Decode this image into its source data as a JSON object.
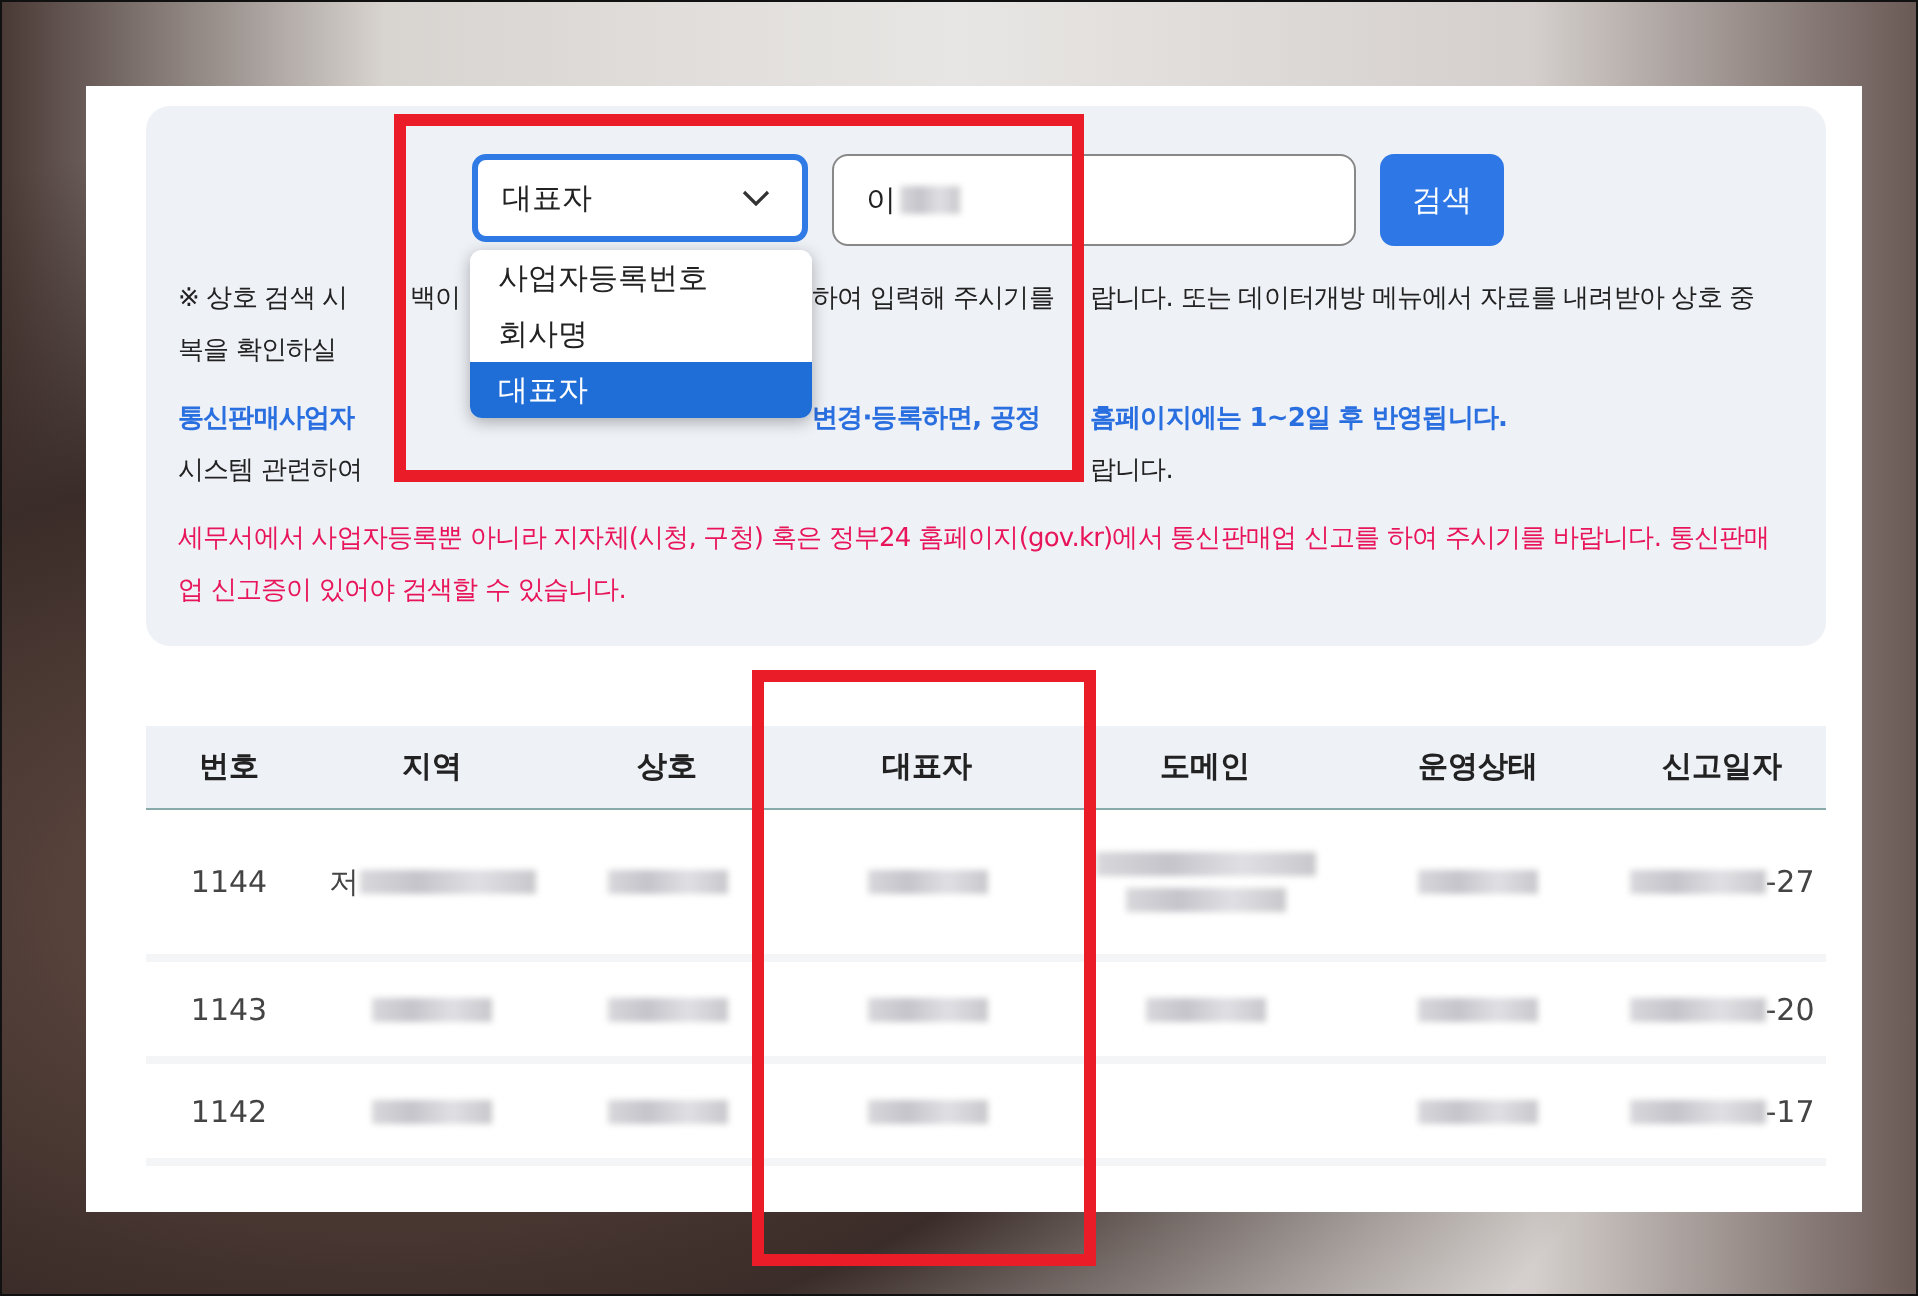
{
  "search": {
    "select": {
      "value": "대표자",
      "expanded": true
    },
    "options": [
      {
        "label": "사업자등록번호",
        "selected": false
      },
      {
        "label": "회사명",
        "selected": false
      },
      {
        "label": "대표자",
        "selected": true
      }
    ],
    "query": {
      "value": "이",
      "redacted": true
    },
    "button": "검색"
  },
  "notice": [
    {
      "kind": "plain",
      "left": "※ 상호 검색 시",
      "after_mark": "백이",
      "right": "하여 입력해 주시기를",
      "tail": "랍니다. 또는 데이터개방 메뉴에서 자료를 내려받아 상호 중"
    },
    {
      "kind": "plain",
      "left": "복을 확인하실"
    },
    {
      "kind": "highlight",
      "left": "통신판매사업자",
      "right": "변경·등록하면, 공정",
      "tail": "홈페이지에는 1~2일 후 반영됩니다."
    },
    {
      "kind": "plain",
      "left": "시스템 관련하여",
      "tail": "랍니다."
    },
    {
      "kind": "warning",
      "text": "세무서에서 사업자등록뿐 아니라 지자체(시청, 구청) 혹은 정부24 홈페이지(gov.kr)에서 통신판매업 신고를 하여 주시기를 바랍니다. 통신판매업 신고증이 있어야 검색할 수 있습니다."
    }
  ],
  "table": {
    "columns": [
      "번호",
      "지역",
      "상호",
      "대표자",
      "도메인",
      "운영상태",
      "신고일자"
    ],
    "rows": [
      {
        "cells": [
          {
            "text": "1144",
            "kind": "plain"
          },
          {
            "text": "저",
            "kind": "after"
          },
          {
            "kind": "full"
          },
          {
            "kind": "full"
          },
          {
            "kind": "double"
          },
          {
            "kind": "full"
          },
          {
            "text": "-27",
            "kind": "before"
          }
        ]
      },
      {
        "cells": [
          {
            "text": "1143",
            "kind": "plain"
          },
          {
            "kind": "full"
          },
          {
            "kind": "full"
          },
          {
            "kind": "full"
          },
          {
            "kind": "full"
          },
          {
            "kind": "full"
          },
          {
            "text": "-20",
            "kind": "before"
          }
        ]
      },
      {
        "cells": [
          {
            "text": "1142",
            "kind": "plain"
          },
          {
            "kind": "full"
          },
          {
            "kind": "full"
          },
          {
            "kind": "full"
          },
          {
            "kind": "plain"
          },
          {
            "kind": "full"
          },
          {
            "text": "-17",
            "kind": "before"
          }
        ]
      }
    ]
  },
  "annotations": [
    {
      "kind": "frame"
    },
    {
      "kind": "frame"
    }
  ]
}
